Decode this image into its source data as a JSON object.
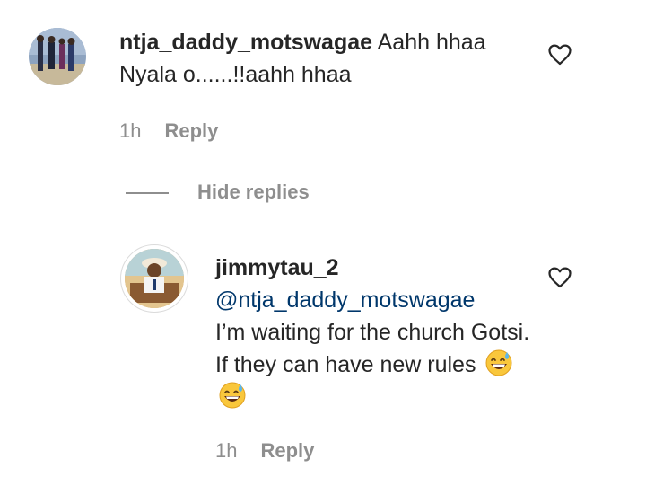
{
  "comments": [
    {
      "username": "ntja_daddy_motswagae",
      "text": "Aahh hhaa Nyala o......!!aahh hhaa",
      "time": "1h",
      "reply_label": "Reply",
      "avatar_icon": "user-avatar"
    }
  ],
  "thread": {
    "hide_replies_label": "Hide replies"
  },
  "replies": [
    {
      "username": "jimmytau_2",
      "mention": "@ntja_daddy_motswagae",
      "text": "I’m waiting for the church Gotsi. If they can have new rules",
      "emoji": "😅😅",
      "time": "1h",
      "reply_label": "Reply",
      "avatar_icon": "user-avatar"
    }
  ],
  "colors": {
    "text": "#262626",
    "secondary": "#8e8e8e",
    "mention": "#00376b"
  },
  "icons": {
    "like": "heart-outline-icon",
    "emoji": "grinning-sweat-emoji"
  }
}
